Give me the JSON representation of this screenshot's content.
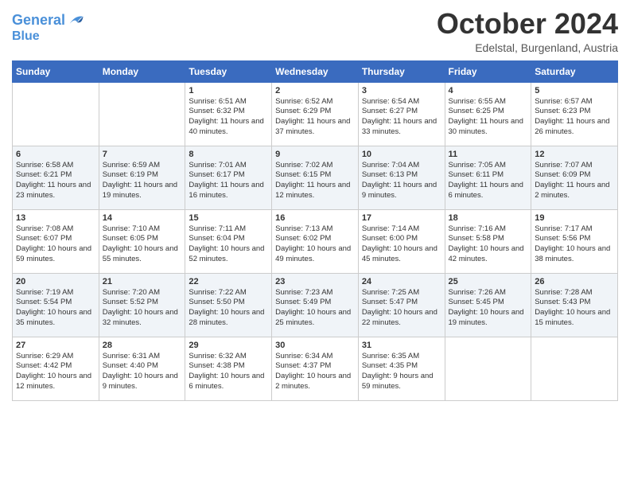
{
  "header": {
    "logo_line1": "General",
    "logo_line2": "Blue",
    "month": "October 2024",
    "location": "Edelstal, Burgenland, Austria"
  },
  "days_of_week": [
    "Sunday",
    "Monday",
    "Tuesday",
    "Wednesday",
    "Thursday",
    "Friday",
    "Saturday"
  ],
  "weeks": [
    [
      {
        "day": "",
        "content": ""
      },
      {
        "day": "",
        "content": ""
      },
      {
        "day": "1",
        "content": "Sunrise: 6:51 AM\nSunset: 6:32 PM\nDaylight: 11 hours and 40 minutes."
      },
      {
        "day": "2",
        "content": "Sunrise: 6:52 AM\nSunset: 6:29 PM\nDaylight: 11 hours and 37 minutes."
      },
      {
        "day": "3",
        "content": "Sunrise: 6:54 AM\nSunset: 6:27 PM\nDaylight: 11 hours and 33 minutes."
      },
      {
        "day": "4",
        "content": "Sunrise: 6:55 AM\nSunset: 6:25 PM\nDaylight: 11 hours and 30 minutes."
      },
      {
        "day": "5",
        "content": "Sunrise: 6:57 AM\nSunset: 6:23 PM\nDaylight: 11 hours and 26 minutes."
      }
    ],
    [
      {
        "day": "6",
        "content": "Sunrise: 6:58 AM\nSunset: 6:21 PM\nDaylight: 11 hours and 23 minutes."
      },
      {
        "day": "7",
        "content": "Sunrise: 6:59 AM\nSunset: 6:19 PM\nDaylight: 11 hours and 19 minutes."
      },
      {
        "day": "8",
        "content": "Sunrise: 7:01 AM\nSunset: 6:17 PM\nDaylight: 11 hours and 16 minutes."
      },
      {
        "day": "9",
        "content": "Sunrise: 7:02 AM\nSunset: 6:15 PM\nDaylight: 11 hours and 12 minutes."
      },
      {
        "day": "10",
        "content": "Sunrise: 7:04 AM\nSunset: 6:13 PM\nDaylight: 11 hours and 9 minutes."
      },
      {
        "day": "11",
        "content": "Sunrise: 7:05 AM\nSunset: 6:11 PM\nDaylight: 11 hours and 6 minutes."
      },
      {
        "day": "12",
        "content": "Sunrise: 7:07 AM\nSunset: 6:09 PM\nDaylight: 11 hours and 2 minutes."
      }
    ],
    [
      {
        "day": "13",
        "content": "Sunrise: 7:08 AM\nSunset: 6:07 PM\nDaylight: 10 hours and 59 minutes."
      },
      {
        "day": "14",
        "content": "Sunrise: 7:10 AM\nSunset: 6:05 PM\nDaylight: 10 hours and 55 minutes."
      },
      {
        "day": "15",
        "content": "Sunrise: 7:11 AM\nSunset: 6:04 PM\nDaylight: 10 hours and 52 minutes."
      },
      {
        "day": "16",
        "content": "Sunrise: 7:13 AM\nSunset: 6:02 PM\nDaylight: 10 hours and 49 minutes."
      },
      {
        "day": "17",
        "content": "Sunrise: 7:14 AM\nSunset: 6:00 PM\nDaylight: 10 hours and 45 minutes."
      },
      {
        "day": "18",
        "content": "Sunrise: 7:16 AM\nSunset: 5:58 PM\nDaylight: 10 hours and 42 minutes."
      },
      {
        "day": "19",
        "content": "Sunrise: 7:17 AM\nSunset: 5:56 PM\nDaylight: 10 hours and 38 minutes."
      }
    ],
    [
      {
        "day": "20",
        "content": "Sunrise: 7:19 AM\nSunset: 5:54 PM\nDaylight: 10 hours and 35 minutes."
      },
      {
        "day": "21",
        "content": "Sunrise: 7:20 AM\nSunset: 5:52 PM\nDaylight: 10 hours and 32 minutes."
      },
      {
        "day": "22",
        "content": "Sunrise: 7:22 AM\nSunset: 5:50 PM\nDaylight: 10 hours and 28 minutes."
      },
      {
        "day": "23",
        "content": "Sunrise: 7:23 AM\nSunset: 5:49 PM\nDaylight: 10 hours and 25 minutes."
      },
      {
        "day": "24",
        "content": "Sunrise: 7:25 AM\nSunset: 5:47 PM\nDaylight: 10 hours and 22 minutes."
      },
      {
        "day": "25",
        "content": "Sunrise: 7:26 AM\nSunset: 5:45 PM\nDaylight: 10 hours and 19 minutes."
      },
      {
        "day": "26",
        "content": "Sunrise: 7:28 AM\nSunset: 5:43 PM\nDaylight: 10 hours and 15 minutes."
      }
    ],
    [
      {
        "day": "27",
        "content": "Sunrise: 6:29 AM\nSunset: 4:42 PM\nDaylight: 10 hours and 12 minutes."
      },
      {
        "day": "28",
        "content": "Sunrise: 6:31 AM\nSunset: 4:40 PM\nDaylight: 10 hours and 9 minutes."
      },
      {
        "day": "29",
        "content": "Sunrise: 6:32 AM\nSunset: 4:38 PM\nDaylight: 10 hours and 6 minutes."
      },
      {
        "day": "30",
        "content": "Sunrise: 6:34 AM\nSunset: 4:37 PM\nDaylight: 10 hours and 2 minutes."
      },
      {
        "day": "31",
        "content": "Sunrise: 6:35 AM\nSunset: 4:35 PM\nDaylight: 9 hours and 59 minutes."
      },
      {
        "day": "",
        "content": ""
      },
      {
        "day": "",
        "content": ""
      }
    ]
  ]
}
